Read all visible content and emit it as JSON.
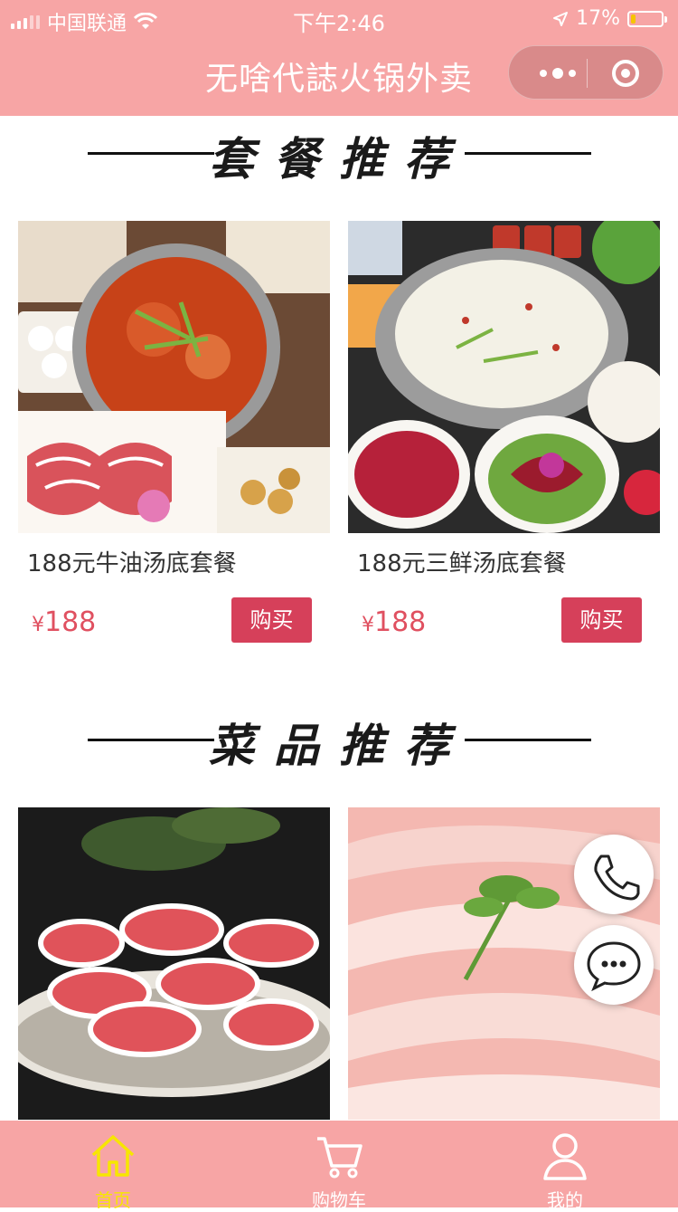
{
  "status_bar": {
    "carrier": "中国联通",
    "time": "下午2:46",
    "battery": "17%",
    "battery_level": 0.17
  },
  "nav": {
    "title": "无啥代誌火锅外卖"
  },
  "sections": {
    "combo_title": "套餐推荐",
    "dish_title": "菜品推荐"
  },
  "combos": [
    {
      "name": "188元牛油汤底套餐",
      "currency": "¥",
      "price": "188",
      "buy_label": "购买"
    },
    {
      "name": "188元三鲜汤底套餐",
      "currency": "¥",
      "price": "188",
      "buy_label": "购买"
    }
  ],
  "tabbar": {
    "items": [
      {
        "label": "首页",
        "icon": "home-icon",
        "active": true
      },
      {
        "label": "购物车",
        "icon": "cart-icon",
        "active": false
      },
      {
        "label": "我的",
        "icon": "user-icon",
        "active": false
      }
    ]
  },
  "colors": {
    "brand_pink": "#f7a5a5",
    "buy_button": "#d6405a",
    "price": "#e05060",
    "tab_active": "#f7e600"
  }
}
